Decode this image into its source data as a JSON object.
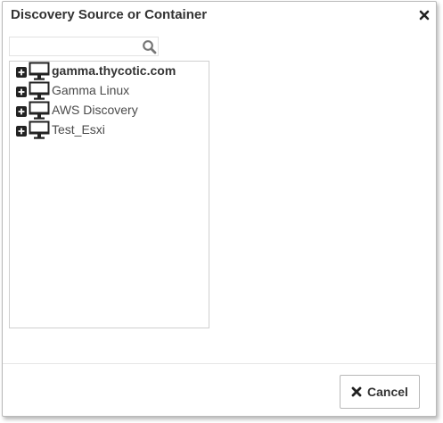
{
  "dialog": {
    "title": "Discovery Source or Container",
    "close_icon": "close-icon"
  },
  "search": {
    "value": "",
    "placeholder": "",
    "icon": "search-icon"
  },
  "tree": {
    "items": [
      {
        "label": "gamma.thycotic.com",
        "bold": true,
        "expand_icon": "plus-square-icon",
        "icon": "monitor-icon"
      },
      {
        "label": "Gamma Linux",
        "bold": false,
        "expand_icon": "plus-square-icon",
        "icon": "monitor-icon"
      },
      {
        "label": "AWS Discovery",
        "bold": false,
        "expand_icon": "plus-square-icon",
        "icon": "monitor-icon"
      },
      {
        "label": "Test_Esxi",
        "bold": false,
        "expand_icon": "plus-square-icon",
        "icon": "monitor-icon"
      }
    ]
  },
  "footer": {
    "cancel_label": "Cancel",
    "cancel_icon": "x-icon"
  },
  "colors": {
    "text": "#333333",
    "border": "#b8b8b8",
    "icon": "#222222"
  }
}
